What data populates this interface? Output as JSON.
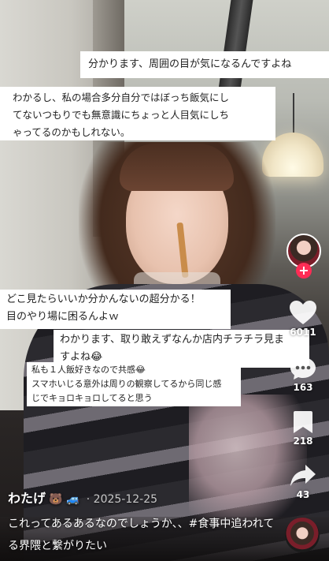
{
  "video": {
    "author": "わたげ",
    "author_emojis": "🐻 🚙",
    "date": "· 2025-12-25",
    "caption": "これってあるあるなのでしょうか、、#食事中追われてる界隈と繋がりたい"
  },
  "comments": [
    {
      "lines": [
        "分かります、周囲の目が気になるんですよね"
      ]
    },
    {
      "lines": [
        "わかるし、私の場合多分自分ではぼっち飯気にし",
        "てないつもりでも無意識にちょっと人目気にしち",
        "ゃってるのかもしれない。"
      ]
    },
    {
      "lines": [
        "どこ見たらいいか分かんないの超分かる！",
        "目のやり場に困るんよｗ"
      ]
    },
    {
      "lines": [
        "わかります、取り敢えずなんか店内チラチラ見ま",
        "すよね😂"
      ]
    },
    {
      "lines": [
        "私も１人飯好きなので共感😂",
        "スマホいじる意外は周りの観察してるから同じ感",
        "じでキョロキョロしてると思う"
      ]
    }
  ],
  "actions": {
    "like_count": "6011",
    "comment_count": "163",
    "save_count": "218",
    "share_count": "43"
  },
  "icons": {
    "like": "heart-icon",
    "comment": "comment-bubble-icon",
    "save": "bookmark-icon",
    "share": "share-arrow-icon",
    "follow": "plus-icon"
  },
  "colors": {
    "follow_accent": "#fe2c55"
  }
}
